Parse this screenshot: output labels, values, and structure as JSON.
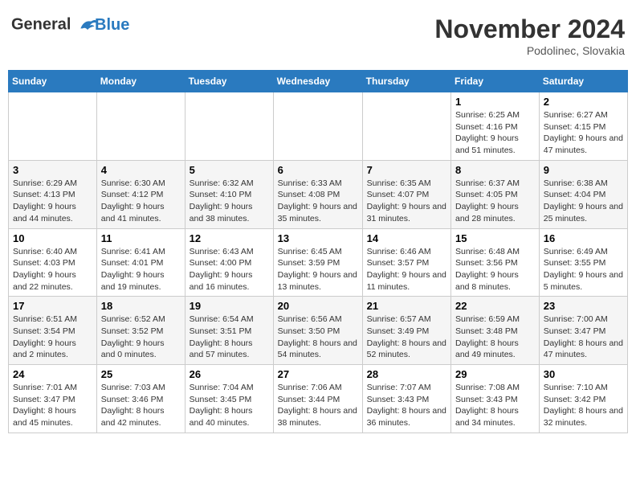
{
  "header": {
    "logo_line1": "General",
    "logo_line2": "Blue",
    "month": "November 2024",
    "location": "Podolinec, Slovakia"
  },
  "days_of_week": [
    "Sunday",
    "Monday",
    "Tuesday",
    "Wednesday",
    "Thursday",
    "Friday",
    "Saturday"
  ],
  "weeks": [
    [
      {
        "day": "",
        "info": ""
      },
      {
        "day": "",
        "info": ""
      },
      {
        "day": "",
        "info": ""
      },
      {
        "day": "",
        "info": ""
      },
      {
        "day": "",
        "info": ""
      },
      {
        "day": "1",
        "info": "Sunrise: 6:25 AM\nSunset: 4:16 PM\nDaylight: 9 hours and 51 minutes."
      },
      {
        "day": "2",
        "info": "Sunrise: 6:27 AM\nSunset: 4:15 PM\nDaylight: 9 hours and 47 minutes."
      }
    ],
    [
      {
        "day": "3",
        "info": "Sunrise: 6:29 AM\nSunset: 4:13 PM\nDaylight: 9 hours and 44 minutes."
      },
      {
        "day": "4",
        "info": "Sunrise: 6:30 AM\nSunset: 4:12 PM\nDaylight: 9 hours and 41 minutes."
      },
      {
        "day": "5",
        "info": "Sunrise: 6:32 AM\nSunset: 4:10 PM\nDaylight: 9 hours and 38 minutes."
      },
      {
        "day": "6",
        "info": "Sunrise: 6:33 AM\nSunset: 4:08 PM\nDaylight: 9 hours and 35 minutes."
      },
      {
        "day": "7",
        "info": "Sunrise: 6:35 AM\nSunset: 4:07 PM\nDaylight: 9 hours and 31 minutes."
      },
      {
        "day": "8",
        "info": "Sunrise: 6:37 AM\nSunset: 4:05 PM\nDaylight: 9 hours and 28 minutes."
      },
      {
        "day": "9",
        "info": "Sunrise: 6:38 AM\nSunset: 4:04 PM\nDaylight: 9 hours and 25 minutes."
      }
    ],
    [
      {
        "day": "10",
        "info": "Sunrise: 6:40 AM\nSunset: 4:03 PM\nDaylight: 9 hours and 22 minutes."
      },
      {
        "day": "11",
        "info": "Sunrise: 6:41 AM\nSunset: 4:01 PM\nDaylight: 9 hours and 19 minutes."
      },
      {
        "day": "12",
        "info": "Sunrise: 6:43 AM\nSunset: 4:00 PM\nDaylight: 9 hours and 16 minutes."
      },
      {
        "day": "13",
        "info": "Sunrise: 6:45 AM\nSunset: 3:59 PM\nDaylight: 9 hours and 13 minutes."
      },
      {
        "day": "14",
        "info": "Sunrise: 6:46 AM\nSunset: 3:57 PM\nDaylight: 9 hours and 11 minutes."
      },
      {
        "day": "15",
        "info": "Sunrise: 6:48 AM\nSunset: 3:56 PM\nDaylight: 9 hours and 8 minutes."
      },
      {
        "day": "16",
        "info": "Sunrise: 6:49 AM\nSunset: 3:55 PM\nDaylight: 9 hours and 5 minutes."
      }
    ],
    [
      {
        "day": "17",
        "info": "Sunrise: 6:51 AM\nSunset: 3:54 PM\nDaylight: 9 hours and 2 minutes."
      },
      {
        "day": "18",
        "info": "Sunrise: 6:52 AM\nSunset: 3:52 PM\nDaylight: 9 hours and 0 minutes."
      },
      {
        "day": "19",
        "info": "Sunrise: 6:54 AM\nSunset: 3:51 PM\nDaylight: 8 hours and 57 minutes."
      },
      {
        "day": "20",
        "info": "Sunrise: 6:56 AM\nSunset: 3:50 PM\nDaylight: 8 hours and 54 minutes."
      },
      {
        "day": "21",
        "info": "Sunrise: 6:57 AM\nSunset: 3:49 PM\nDaylight: 8 hours and 52 minutes."
      },
      {
        "day": "22",
        "info": "Sunrise: 6:59 AM\nSunset: 3:48 PM\nDaylight: 8 hours and 49 minutes."
      },
      {
        "day": "23",
        "info": "Sunrise: 7:00 AM\nSunset: 3:47 PM\nDaylight: 8 hours and 47 minutes."
      }
    ],
    [
      {
        "day": "24",
        "info": "Sunrise: 7:01 AM\nSunset: 3:47 PM\nDaylight: 8 hours and 45 minutes."
      },
      {
        "day": "25",
        "info": "Sunrise: 7:03 AM\nSunset: 3:46 PM\nDaylight: 8 hours and 42 minutes."
      },
      {
        "day": "26",
        "info": "Sunrise: 7:04 AM\nSunset: 3:45 PM\nDaylight: 8 hours and 40 minutes."
      },
      {
        "day": "27",
        "info": "Sunrise: 7:06 AM\nSunset: 3:44 PM\nDaylight: 8 hours and 38 minutes."
      },
      {
        "day": "28",
        "info": "Sunrise: 7:07 AM\nSunset: 3:43 PM\nDaylight: 8 hours and 36 minutes."
      },
      {
        "day": "29",
        "info": "Sunrise: 7:08 AM\nSunset: 3:43 PM\nDaylight: 8 hours and 34 minutes."
      },
      {
        "day": "30",
        "info": "Sunrise: 7:10 AM\nSunset: 3:42 PM\nDaylight: 8 hours and 32 minutes."
      }
    ]
  ]
}
